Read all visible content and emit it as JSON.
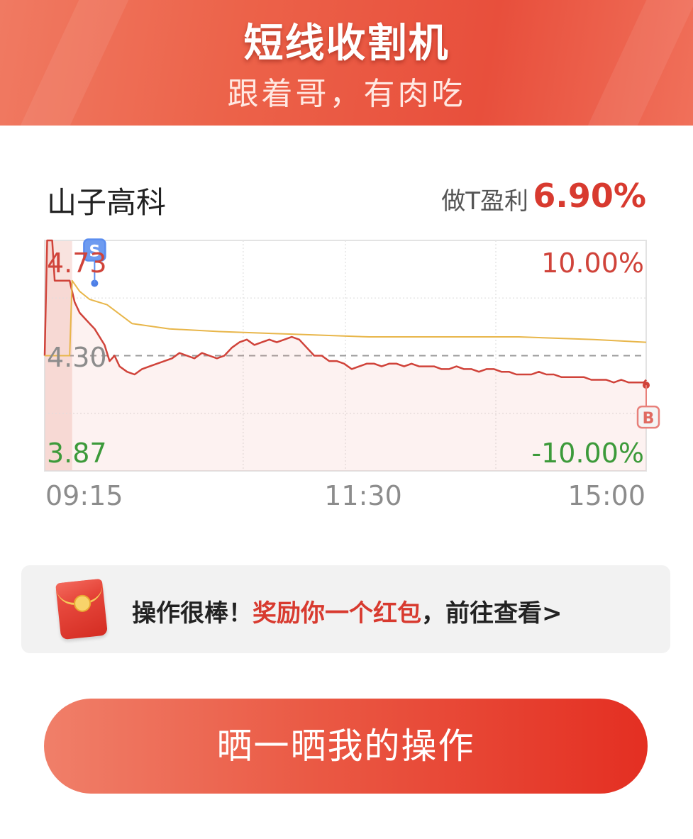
{
  "header": {
    "title": "短线收割机",
    "subtitle": "跟着哥，有肉吃"
  },
  "stock": {
    "name": "山子高科",
    "profit_label": "做T盈利",
    "profit_value": "6.90%"
  },
  "chart_data": {
    "type": "line",
    "title": "",
    "y_labels": {
      "high": "4.73",
      "prev_close": "4.30",
      "low": "3.87"
    },
    "pct_labels": {
      "high": "10.00%",
      "low": "-10.00%"
    },
    "x_labels": [
      "09:15",
      "11:30",
      "15:00"
    ],
    "ylim": [
      3.87,
      4.73
    ],
    "prev_close": 4.3,
    "markers": [
      {
        "label": "S",
        "side": "sell",
        "time_index": 20,
        "price": 4.57
      },
      {
        "label": "B",
        "side": "buy",
        "time_index": 241,
        "price": 4.19
      }
    ],
    "series": [
      {
        "color": "#d0433a",
        "x": [
          0,
          1,
          2,
          3,
          4,
          5,
          6,
          7,
          8,
          9,
          10,
          12,
          14,
          16,
          18,
          20,
          22,
          24,
          26,
          28,
          30,
          33,
          36,
          39,
          42,
          45,
          48,
          51,
          54,
          57,
          60,
          63,
          66,
          69,
          72,
          75,
          78,
          81,
          84,
          87,
          90,
          93,
          96,
          99,
          102,
          105,
          108,
          111,
          114,
          117,
          120,
          123,
          126,
          129,
          132,
          135,
          138,
          141,
          144,
          147,
          150,
          153,
          156,
          159,
          162,
          165,
          168,
          171,
          174,
          177,
          180,
          183,
          186,
          189,
          192,
          195,
          198,
          201,
          204,
          207,
          210,
          213,
          216,
          219,
          222,
          225,
          228,
          231,
          234,
          237,
          240,
          241
        ],
        "values": [
          4.3,
          4.73,
          4.73,
          4.73,
          4.58,
          4.58,
          4.58,
          4.58,
          4.58,
          4.58,
          4.58,
          4.5,
          4.46,
          4.44,
          4.42,
          4.4,
          4.37,
          4.34,
          4.28,
          4.3,
          4.26,
          4.24,
          4.23,
          4.25,
          4.26,
          4.27,
          4.28,
          4.29,
          4.31,
          4.3,
          4.29,
          4.31,
          4.3,
          4.29,
          4.3,
          4.33,
          4.35,
          4.36,
          4.34,
          4.35,
          4.36,
          4.35,
          4.36,
          4.37,
          4.36,
          4.33,
          4.3,
          4.3,
          4.28,
          4.28,
          4.27,
          4.25,
          4.26,
          4.27,
          4.27,
          4.26,
          4.27,
          4.27,
          4.26,
          4.27,
          4.26,
          4.26,
          4.26,
          4.25,
          4.25,
          4.26,
          4.25,
          4.25,
          4.24,
          4.25,
          4.25,
          4.24,
          4.24,
          4.23,
          4.23,
          4.23,
          4.24,
          4.23,
          4.23,
          4.22,
          4.22,
          4.22,
          4.22,
          4.21,
          4.21,
          4.21,
          4.2,
          4.21,
          4.2,
          4.2,
          4.2,
          4.21
        ]
      },
      {
        "color": "#e8b64a",
        "x": [
          0,
          10,
          11,
          14,
          18,
          25,
          35,
          50,
          70,
          100,
          130,
          160,
          190,
          220,
          241
        ],
        "values": [
          4.3,
          4.3,
          4.58,
          4.54,
          4.51,
          4.49,
          4.42,
          4.4,
          4.39,
          4.38,
          4.37,
          4.37,
          4.37,
          4.36,
          4.35
        ]
      }
    ]
  },
  "reward": {
    "prefix": "操作很棒！",
    "highlight": "奖励你一个红包",
    "suffix": "，前往查看>"
  },
  "share_button": {
    "label": "晒一晒我的操作"
  }
}
